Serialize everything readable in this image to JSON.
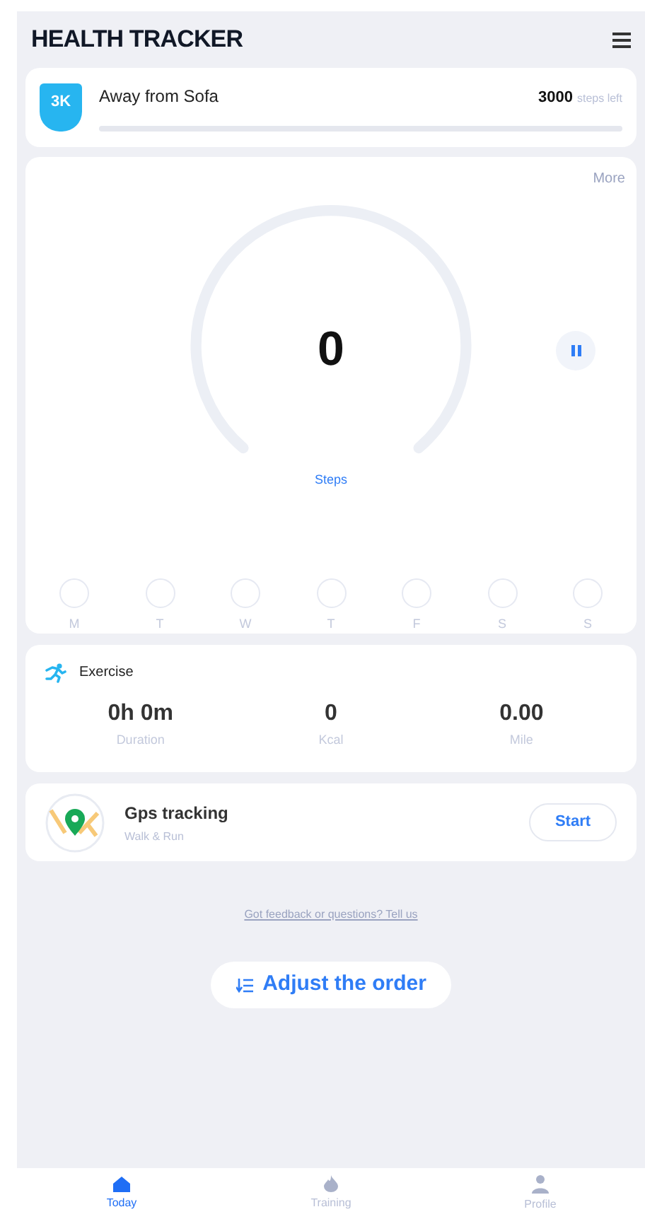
{
  "header": {
    "title": "HEALTH TRACKER"
  },
  "goal": {
    "badge": "3K",
    "name": "Away from Sofa",
    "remaining": "3000",
    "remaining_unit": "steps left"
  },
  "steps": {
    "more": "More",
    "count": "0",
    "label": "Steps",
    "days": [
      "M",
      "T",
      "W",
      "T",
      "F",
      "S",
      "S"
    ]
  },
  "exercise": {
    "title": "Exercise",
    "stats": [
      {
        "value": "0h 0m",
        "label": "Duration"
      },
      {
        "value": "0",
        "label": "Kcal"
      },
      {
        "value": "0.00",
        "label": "Mile"
      }
    ]
  },
  "gps": {
    "title": "Gps tracking",
    "subtitle": "Walk & Run",
    "button": "Start"
  },
  "feedback_link": "Got feedback or questions? Tell us",
  "adjust_button": "Adjust the order",
  "tabs": [
    {
      "label": "Today",
      "selected": true
    },
    {
      "label": "Training",
      "selected": false
    },
    {
      "label": "Profile",
      "selected": false
    }
  ]
}
